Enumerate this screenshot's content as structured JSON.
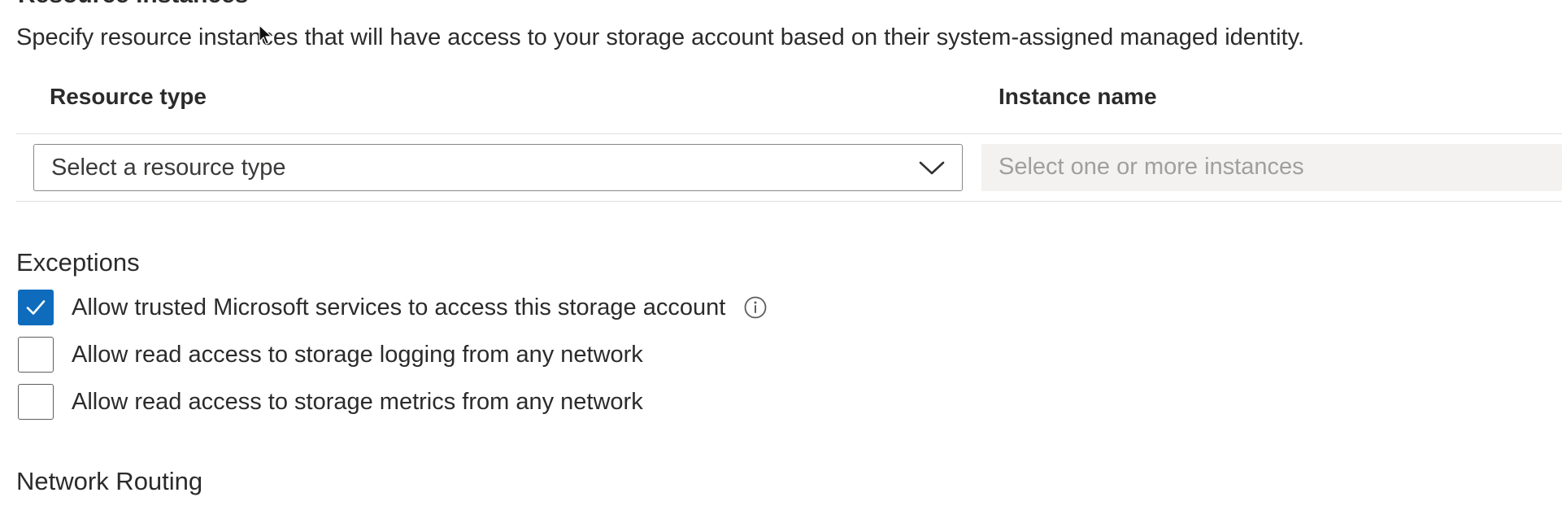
{
  "section": {
    "title": "Resource instances",
    "description": "Specify resource instances that will have access to your storage account based on their system-assigned managed identity."
  },
  "table": {
    "columns": [
      "Resource type",
      "Instance name"
    ],
    "resource_type_placeholder": "Select a resource type",
    "instance_placeholder": "Select one or more instances"
  },
  "exceptions": {
    "title": "Exceptions",
    "items": [
      {
        "label": "Allow trusted Microsoft services to access this storage account",
        "checked": true,
        "info_icon": "info-icon"
      },
      {
        "label": "Allow read access to storage logging from any network",
        "checked": false
      },
      {
        "label": "Allow read access to storage metrics from any network",
        "checked": false
      }
    ]
  },
  "network_routing": {
    "title": "Network Routing"
  },
  "colors": {
    "accent": "#0f6cbd",
    "border": "#8a8886",
    "disabled_bg": "#f3f2f1",
    "placeholder_disabled": "#a19f9d"
  }
}
